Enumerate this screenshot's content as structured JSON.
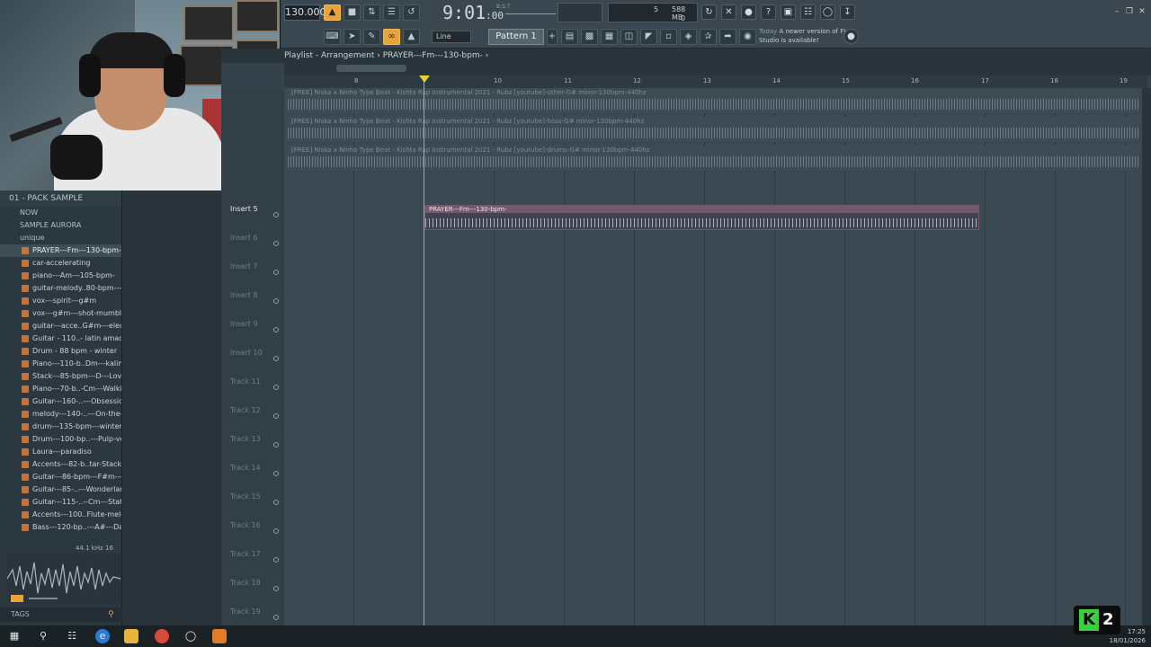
{
  "toolbar": {
    "tempo": "130.000",
    "time_main": "9:01",
    "time_ticks": ":00",
    "time_hint": "B:S:T",
    "memory": "588 MB",
    "cpu": "5",
    "voices": "0",
    "snap_mode": "Line",
    "pattern": "Pattern 1",
    "update_prefix": "Today",
    "update_text": "A newer version of FL Studio is available!"
  },
  "browser": {
    "header": "01 - PACK SAMPLE",
    "folders": [
      "NOW",
      "SAMPLE AURORA",
      "unique"
    ],
    "selected_file": "PRAYER---Fm---130-bpm-",
    "files": [
      "car-accelerating",
      "piano---Am---105-bpm-",
      "guitar-melody..80-bpm---c#",
      "vox---spirit---g#m",
      "vox---g#m---shot-mumble",
      "guitar---acce..G#m---electric",
      "Guitar - 110..- latin amadeo",
      "Drum - 88 bpm - winter",
      "Piano---110-b..Dm---kalimba",
      "Stack---85-bpm---D---Love",
      "Piano---70-b..-Cm---Walking",
      "Guitar---160-..---Obsession",
      "melody---140-..---On-the-go",
      "drum---135-bpm---winter",
      "Drum---100-bp..---Pulp-verb",
      "Laura---paradiso",
      "Accents---82-b..tar-Stack-lofi",
      "Guitar---86-bpm---F#m---PJ",
      "Guitar---85-..---Wonderland",
      "Guitar---115-..--Cm---Station",
      "Accents---100..Flute-melody",
      "Bass---120-bp..---A#---Dance"
    ],
    "sample_info": "44.1 kHz 16",
    "tags_label": "TAGS"
  },
  "playlist": {
    "title_prefix": "Playlist - Arrangement",
    "title_pattern": "PRAYER---Fm---130-bpm-",
    "ruler": [
      "8",
      "10",
      "11",
      "12",
      "13",
      "14",
      "15",
      "16",
      "17",
      "18",
      "19"
    ],
    "audio_tracks": [
      "[FREE] Niska x Ninho Type Beat - Kishta  Rap Instrumental 2021 - Rubz [youtube]-other-G# minor-130bpm-440hz",
      "[FREE] Niska x Ninho Type Beat - Kishta  Rap Instrumental 2021 - Rubz [youtube]-bass-G# minor-130bpm-440hz",
      "[FREE] Niska x Ninho Type Beat - Kishta  Rap Instrumental 2021 - Rubz [youtube]-drums-G# minor-130bpm-440hz"
    ],
    "clip_label": "PRAYER---Fm---130-bpm-",
    "tracks": [
      "Insert 5",
      "Insert 6",
      "Insert 7",
      "Insert 8",
      "Insert 9",
      "Insert 10",
      "Track 11",
      "Track 12",
      "Track 13",
      "Track 14",
      "Track 15",
      "Track 16",
      "Track 17",
      "Track 18",
      "Track 19"
    ]
  },
  "taskbar": {
    "time": "17:25",
    "date": "18/01/2026"
  },
  "watermark": "K2"
}
